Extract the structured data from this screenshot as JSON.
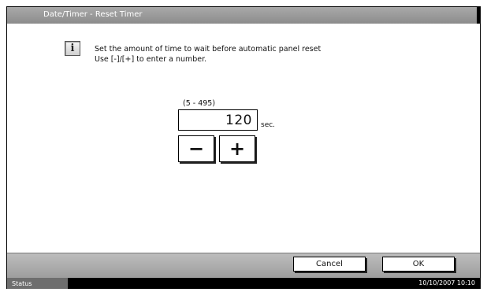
{
  "window": {
    "title": "Date/Timer - Reset Timer"
  },
  "message": {
    "icon": "info-icon",
    "line1": "Set the amount of time to wait before automatic panel reset",
    "line2": "Use [-]/[+] to enter a number."
  },
  "timer": {
    "range": "(5 - 495)",
    "value": "120",
    "unit": "sec.",
    "minus_label": "−",
    "plus_label": "+"
  },
  "actions": {
    "cancel_label": "Cancel",
    "ok_label": "OK"
  },
  "status_bar": {
    "tab_label": "Status",
    "datetime": "10/10/2007   10:10"
  },
  "colors": {
    "title_bar": "#999999",
    "bottom_bar": "#aaaaaa",
    "status_bar": "#000000"
  }
}
